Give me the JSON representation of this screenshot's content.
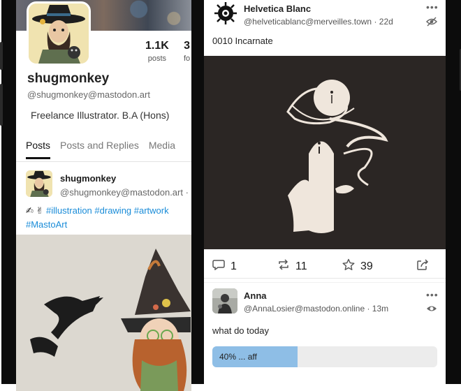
{
  "profile": {
    "name": "shugmonkey",
    "handle": "@shugmonkey@mastodon.art",
    "bio": "Freelance Illustrator. B.A (Hons)",
    "posts_count": "1.1K",
    "posts_label": "posts",
    "following_count": "3",
    "following_label": "fo",
    "tabs": [
      "Posts",
      "Posts and Replies",
      "Media"
    ],
    "post": {
      "author": "shugmonkey",
      "handle": "@shugmonkey@mastodon.art ·",
      "emoji": "✍ ✌",
      "hashtags_line1": "#illustration #drawing #artwork",
      "hashtags_line2": "#MastoArt"
    }
  },
  "feed": {
    "post1": {
      "author": "Helvetica Blanc",
      "handle": "@helveticablanc@merveilles.town · 22d",
      "text": "0010 Incarnate",
      "replies": "1",
      "boosts": "11",
      "favourites": "39"
    },
    "post2": {
      "author": "Anna",
      "handle": "@AnnaLosier@mastodon.online · 13m",
      "text": "what do today",
      "poll_option": "40% ... aff",
      "poll_fill": 0.38
    }
  },
  "icons": [
    "reply-icon",
    "boost-icon",
    "star-icon",
    "share-icon",
    "more-icon",
    "eye-icon",
    "eye-off-icon"
  ],
  "colors": {
    "link": "#1a8cd8",
    "poll_fill": "#8ebee6",
    "media_bg": "#2a2523"
  }
}
